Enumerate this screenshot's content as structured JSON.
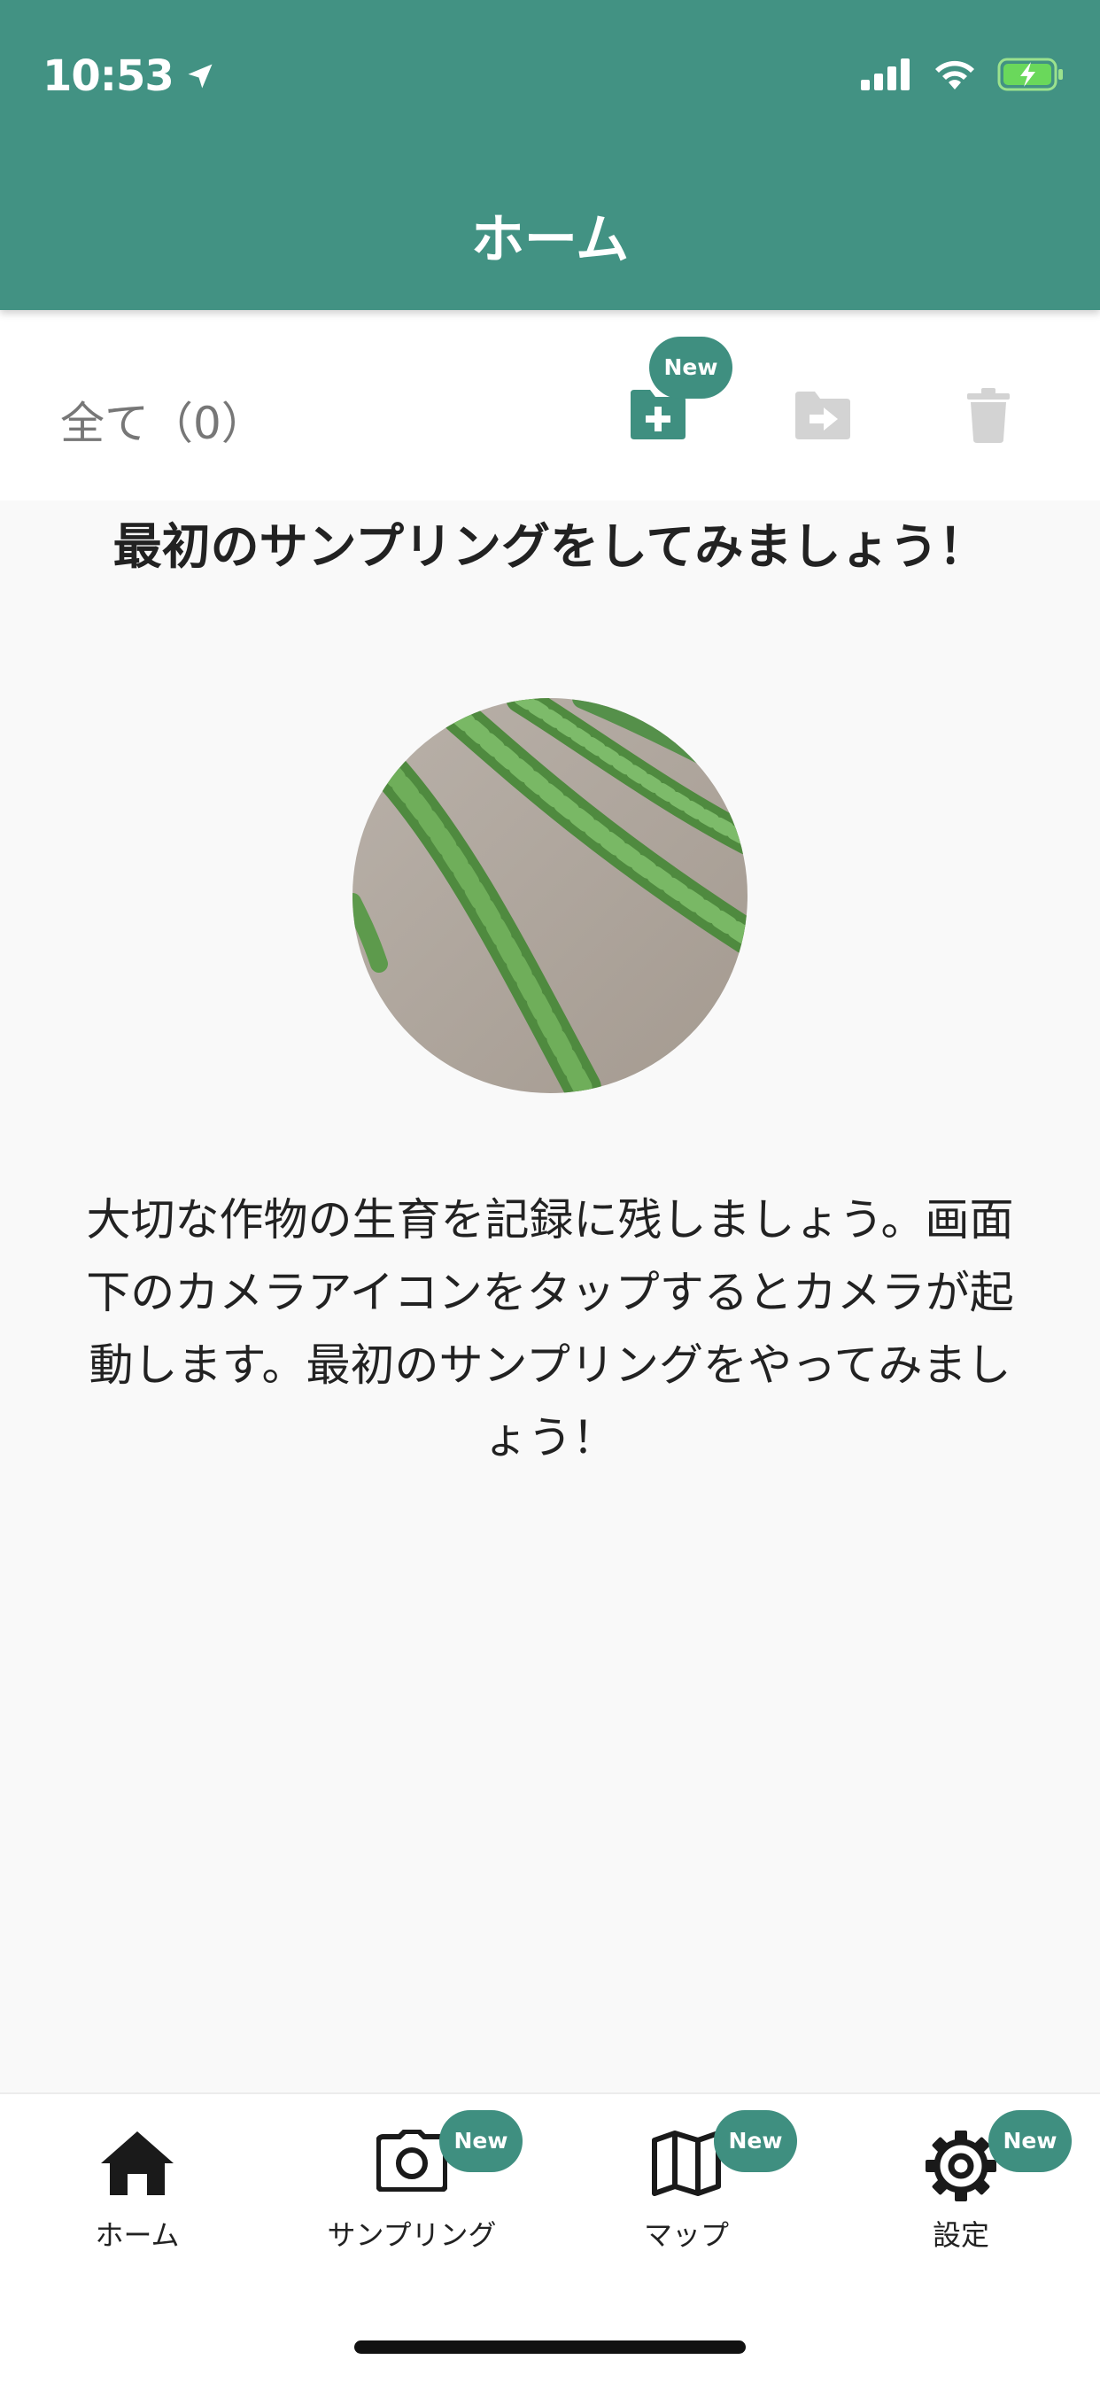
{
  "status_bar": {
    "time": "10:53"
  },
  "header": {
    "title": "ホーム"
  },
  "toolbar": {
    "filter_label": "全て（0）",
    "add_folder_badge": "New"
  },
  "main": {
    "prompt_title": "最初のサンプリングをしてみましょう！",
    "description_lines": [
      "大切な作物の生育を記録に残しましょう。画面",
      "下のカメラアイコンをタップするとカメラが起",
      "動します。最初のサンプリングをやってみまし",
      "ょう！"
    ]
  },
  "tabbar": {
    "items": [
      {
        "label": "ホーム",
        "icon": "home-icon",
        "badge": ""
      },
      {
        "label": "サンプリング",
        "icon": "camera-icon",
        "badge": "New"
      },
      {
        "label": "マップ",
        "icon": "map-icon",
        "badge": "New"
      },
      {
        "label": "設定",
        "icon": "gear-icon",
        "badge": "New"
      }
    ]
  },
  "colors": {
    "header": "#429283",
    "badge": "#3f8f80",
    "disabled_icon": "#d3d3d3"
  }
}
